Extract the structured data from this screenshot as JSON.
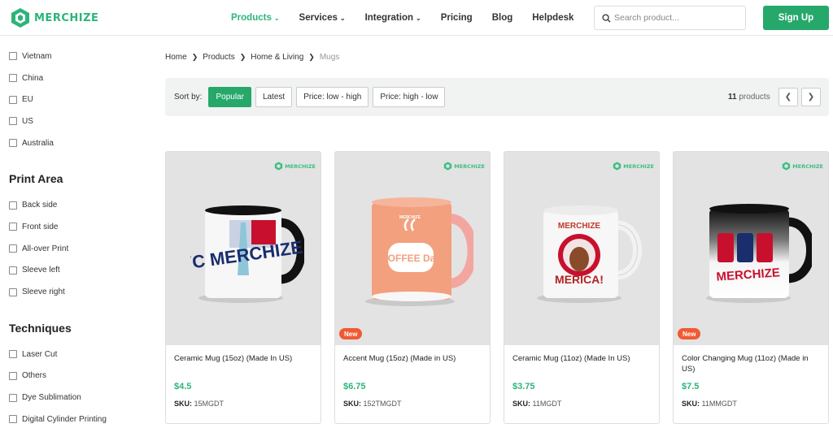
{
  "header": {
    "logo_text": "MERCHIZE",
    "nav": [
      {
        "label": "Products",
        "caret": true,
        "active": true
      },
      {
        "label": "Services",
        "caret": true,
        "active": false
      },
      {
        "label": "Integration",
        "caret": true,
        "active": false
      },
      {
        "label": "Pricing",
        "caret": false,
        "active": false
      },
      {
        "label": "Blog",
        "caret": false,
        "active": false
      },
      {
        "label": "Helpdesk",
        "caret": false,
        "active": false
      }
    ],
    "search_placeholder": "Search product...",
    "signup_label": "Sign Up"
  },
  "sidebar": {
    "countries": [
      "Vietnam",
      "China",
      "EU",
      "US",
      "Australia"
    ],
    "print_area_title": "Print Area",
    "print_areas": [
      "Back side",
      "Front side",
      "All-over Print",
      "Sleeve left",
      "Sleeve right"
    ],
    "techniques_title": "Techniques",
    "techniques": [
      "Laser Cut",
      "Others",
      "Dye Sublimation",
      "Digital Cylinder Printing"
    ]
  },
  "breadcrumb": [
    "Home",
    "Products",
    "Home & Living",
    "Mugs"
  ],
  "sortbar": {
    "label": "Sort by:",
    "options": [
      "Popular",
      "Latest",
      "Price: low - high",
      "Price: high - low"
    ],
    "active": "Popular",
    "count_number": "11",
    "count_label": "products",
    "prev_icon": "chevron-left-icon",
    "next_icon": "chevron-right-icon"
  },
  "products": [
    {
      "name": "Ceramic Mug (15oz) (Made In US)",
      "price": "$4.5",
      "sku_label": "SKU:",
      "sku": "15MGDT",
      "badge": "",
      "brand": "MERCHIZE"
    },
    {
      "name": "Accent Mug (15oz) (Made in US)",
      "price": "$6.75",
      "sku_label": "SKU:",
      "sku": "152TMGDT",
      "badge": "New",
      "brand": "MERCHIZE"
    },
    {
      "name": "Ceramic Mug (11oz) (Made In US)",
      "price": "$3.75",
      "sku_label": "SKU:",
      "sku": "11MGDT",
      "badge": "",
      "brand": "MERCHIZE"
    },
    {
      "name": "Color Changing Mug (11oz) (Made in US)",
      "price": "$7.5",
      "sku_label": "SKU:",
      "sku": "11MMGDT",
      "badge": "New",
      "brand": "MERCHIZE"
    }
  ],
  "mug_art": {
    "mug1": "NYC MERCHIZE",
    "mug2": "COFFEE Day",
    "mug2_brand": "MERCHIZE",
    "mug3_top": "MERCHIZE",
    "mug3_bottom": "MERICA!",
    "mug4": "MERCHIZE"
  },
  "colors": {
    "brand": "#2db47a",
    "button": "#26a86b",
    "badge": "#f05a33"
  }
}
